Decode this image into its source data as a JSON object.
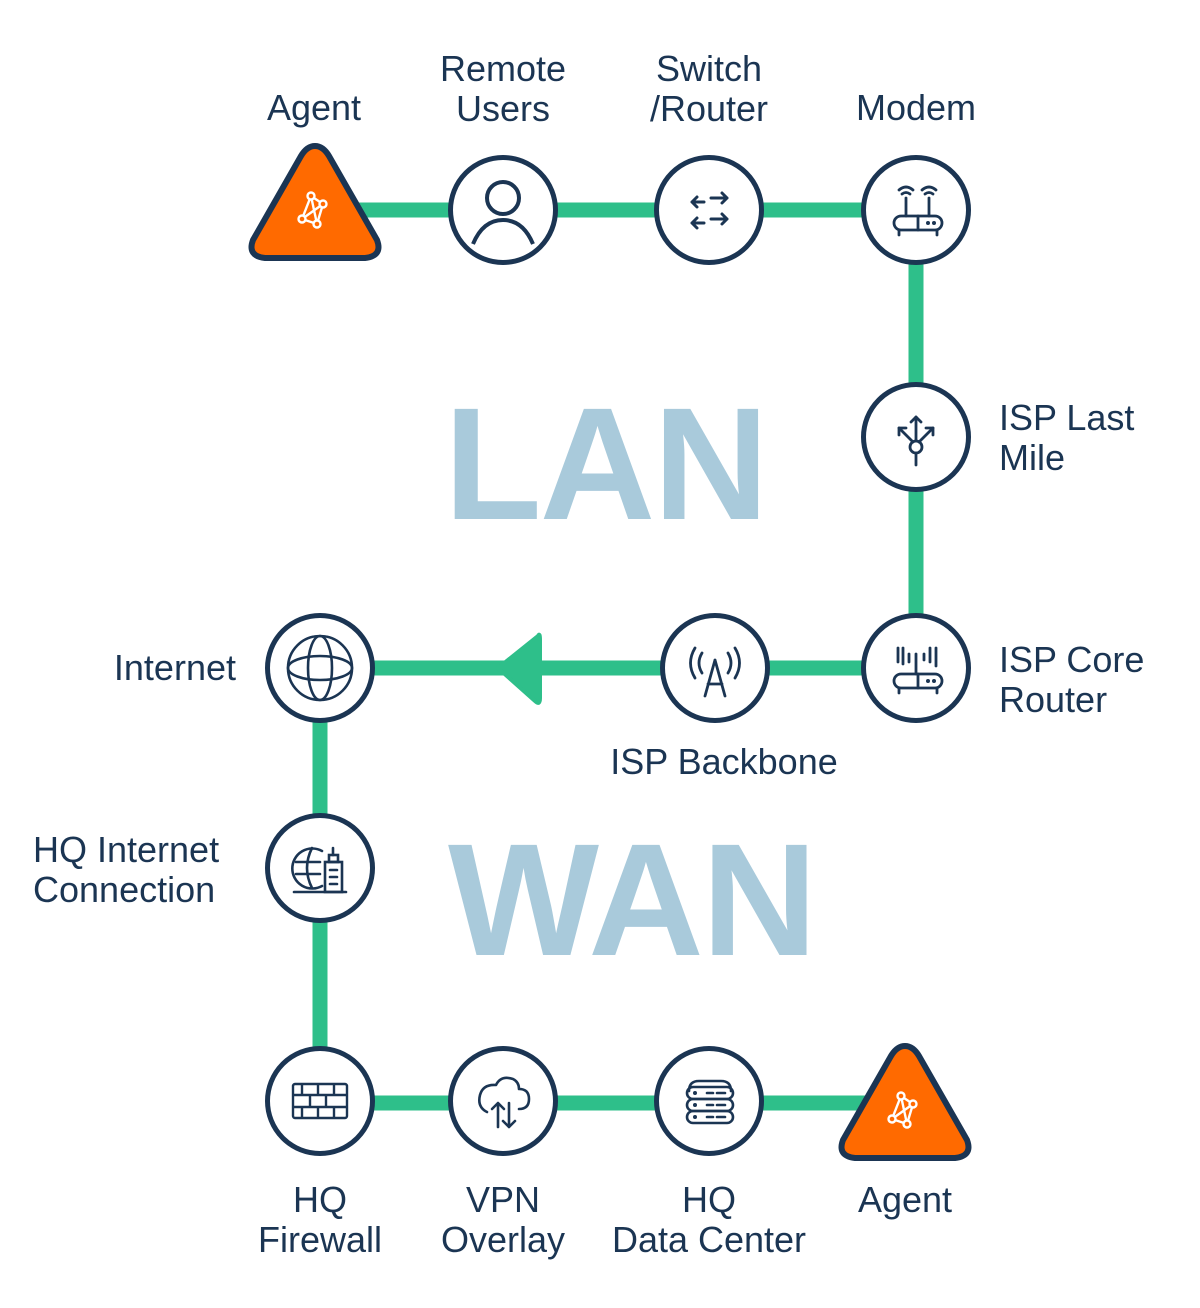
{
  "colors": {
    "link": "#2ebf8a",
    "node_stroke": "#1b3553",
    "agent_fill": "#ff6a00",
    "big_label": "#a9cadb",
    "text": "#1b3553"
  },
  "sections": {
    "lan": "LAN",
    "wan": "WAN"
  },
  "nodes": [
    {
      "id": "agent-start",
      "label": "Agent",
      "icon": "network-mesh-icon",
      "shape": "triangle"
    },
    {
      "id": "remote-users",
      "label": "Remote\nUsers",
      "icon": "user-icon",
      "shape": "circle"
    },
    {
      "id": "switch-router",
      "label": "Switch\n/Router",
      "icon": "bidirectional-arrows-icon",
      "shape": "circle"
    },
    {
      "id": "modem",
      "label": "Modem",
      "icon": "wifi-router-icon",
      "shape": "circle"
    },
    {
      "id": "isp-last-mile",
      "label": "ISP Last\nMile",
      "icon": "branching-arrows-icon",
      "shape": "circle"
    },
    {
      "id": "isp-core-router",
      "label": "ISP Core\nRouter",
      "icon": "signal-router-icon",
      "shape": "circle"
    },
    {
      "id": "isp-backbone",
      "label": "ISP Backbone",
      "icon": "antenna-tower-icon",
      "shape": "circle"
    },
    {
      "id": "internet",
      "label": "Internet",
      "icon": "globe-icon",
      "shape": "circle"
    },
    {
      "id": "hq-internet-connection",
      "label": "HQ Internet\nConnection",
      "icon": "globe-building-icon",
      "shape": "circle"
    },
    {
      "id": "hq-firewall",
      "label": "HQ\nFirewall",
      "icon": "brick-wall-icon",
      "shape": "circle"
    },
    {
      "id": "vpn-overlay",
      "label": "VPN\nOverlay",
      "icon": "cloud-transfer-icon",
      "shape": "circle"
    },
    {
      "id": "hq-data-center",
      "label": "HQ\nData Center",
      "icon": "server-stack-icon",
      "shape": "circle"
    },
    {
      "id": "agent-end",
      "label": "Agent",
      "icon": "network-mesh-icon",
      "shape": "triangle"
    }
  ],
  "flow_direction": "ISP Backbone → Internet"
}
